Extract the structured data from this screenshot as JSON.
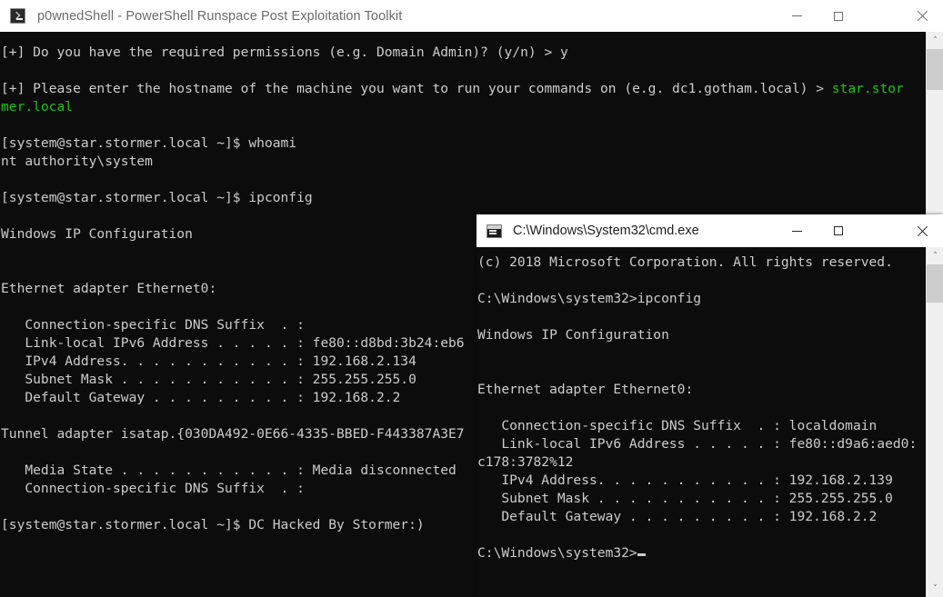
{
  "powershell_window": {
    "title": "p0wnedShell - PowerShell Runspace Post Exploitation Toolkit",
    "icon": "powershell-prompt-icon",
    "controls": {
      "minimize": "minimize-icon",
      "maximize": "maximize-icon",
      "close": "close-icon"
    },
    "scrollbar": {
      "up_arrow": "˄",
      "down_arrow": "˅"
    },
    "lines": [
      {
        "segments": [
          {
            "text": "[+] Do you have the required permissions (e.g. Domain Admin)? (y/n) > y",
            "color": "default"
          }
        ]
      },
      {
        "segments": [
          {
            "text": "",
            "color": "default"
          }
        ]
      },
      {
        "segments": [
          {
            "text": "[+] Please enter the hostname of the machine you want to run your commands on (e.g. dc1.gotham.local) > ",
            "color": "default"
          },
          {
            "text": "star.stor",
            "color": "green"
          }
        ]
      },
      {
        "segments": [
          {
            "text": "mer.local",
            "color": "green"
          }
        ]
      },
      {
        "segments": [
          {
            "text": "",
            "color": "default"
          }
        ]
      },
      {
        "segments": [
          {
            "text": "[system@star.stormer.local ~]$ whoami",
            "color": "default"
          }
        ]
      },
      {
        "segments": [
          {
            "text": "nt authority\\system",
            "color": "default"
          }
        ]
      },
      {
        "segments": [
          {
            "text": "",
            "color": "default"
          }
        ]
      },
      {
        "segments": [
          {
            "text": "[system@star.stormer.local ~]$ ipconfig",
            "color": "default"
          }
        ]
      },
      {
        "segments": [
          {
            "text": "",
            "color": "default"
          }
        ]
      },
      {
        "segments": [
          {
            "text": "Windows IP Configuration",
            "color": "default"
          }
        ]
      },
      {
        "segments": [
          {
            "text": "",
            "color": "default"
          }
        ]
      },
      {
        "segments": [
          {
            "text": "",
            "color": "default"
          }
        ]
      },
      {
        "segments": [
          {
            "text": "Ethernet adapter Ethernet0:",
            "color": "default"
          }
        ]
      },
      {
        "segments": [
          {
            "text": "",
            "color": "default"
          }
        ]
      },
      {
        "segments": [
          {
            "text": "   Connection-specific DNS Suffix  . :",
            "color": "default"
          }
        ]
      },
      {
        "segments": [
          {
            "text": "   Link-local IPv6 Address . . . . . : fe80::d8bd:3b24:eb6",
            "color": "default"
          }
        ]
      },
      {
        "segments": [
          {
            "text": "   IPv4 Address. . . . . . . . . . . : 192.168.2.134",
            "color": "default"
          }
        ]
      },
      {
        "segments": [
          {
            "text": "   Subnet Mask . . . . . . . . . . . : 255.255.255.0",
            "color": "default"
          }
        ]
      },
      {
        "segments": [
          {
            "text": "   Default Gateway . . . . . . . . . : 192.168.2.2",
            "color": "default"
          }
        ]
      },
      {
        "segments": [
          {
            "text": "",
            "color": "default"
          }
        ]
      },
      {
        "segments": [
          {
            "text": "Tunnel adapter isatap.{030DA492-0E66-4335-BBED-F443387A3E7",
            "color": "default"
          }
        ]
      },
      {
        "segments": [
          {
            "text": "",
            "color": "default"
          }
        ]
      },
      {
        "segments": [
          {
            "text": "   Media State . . . . . . . . . . . : Media disconnected",
            "color": "default"
          }
        ]
      },
      {
        "segments": [
          {
            "text": "   Connection-specific DNS Suffix  . :",
            "color": "default"
          }
        ]
      },
      {
        "segments": [
          {
            "text": "",
            "color": "default"
          }
        ]
      },
      {
        "segments": [
          {
            "text": "[system@star.stormer.local ~]$ DC Hacked By Stormer:)",
            "color": "default"
          }
        ]
      }
    ]
  },
  "cmd_window": {
    "title": "C:\\Windows\\System32\\cmd.exe",
    "icon": "console-window-icon",
    "controls": {
      "minimize": "minimize-icon",
      "maximize": "maximize-icon",
      "close": "close-icon"
    },
    "scrollbar": {
      "up_arrow": "˄",
      "down_arrow": "˅"
    },
    "lines": [
      {
        "segments": [
          {
            "text": "(c) 2018 Microsoft Corporation. All rights reserved.",
            "color": "default"
          }
        ]
      },
      {
        "segments": [
          {
            "text": "",
            "color": "default"
          }
        ]
      },
      {
        "segments": [
          {
            "text": "C:\\Windows\\system32>ipconfig",
            "color": "default"
          }
        ]
      },
      {
        "segments": [
          {
            "text": "",
            "color": "default"
          }
        ]
      },
      {
        "segments": [
          {
            "text": "Windows IP Configuration",
            "color": "default"
          }
        ]
      },
      {
        "segments": [
          {
            "text": "",
            "color": "default"
          }
        ]
      },
      {
        "segments": [
          {
            "text": "",
            "color": "default"
          }
        ]
      },
      {
        "segments": [
          {
            "text": "Ethernet adapter Ethernet0:",
            "color": "default"
          }
        ]
      },
      {
        "segments": [
          {
            "text": "",
            "color": "default"
          }
        ]
      },
      {
        "segments": [
          {
            "text": "   Connection-specific DNS Suffix  . : localdomain",
            "color": "default"
          }
        ]
      },
      {
        "segments": [
          {
            "text": "   Link-local IPv6 Address . . . . . : fe80::d9a6:aed0:",
            "color": "default"
          }
        ]
      },
      {
        "segments": [
          {
            "text": "c178:3782%12",
            "color": "default"
          }
        ]
      },
      {
        "segments": [
          {
            "text": "   IPv4 Address. . . . . . . . . . . : 192.168.2.139",
            "color": "default"
          }
        ]
      },
      {
        "segments": [
          {
            "text": "   Subnet Mask . . . . . . . . . . . : 255.255.255.0",
            "color": "default"
          }
        ]
      },
      {
        "segments": [
          {
            "text": "   Default Gateway . . . . . . . . . : 192.168.2.2",
            "color": "default"
          }
        ]
      },
      {
        "segments": [
          {
            "text": "",
            "color": "default"
          }
        ]
      },
      {
        "segments": [
          {
            "text": "C:\\Windows\\system32>",
            "color": "default",
            "cursor": true
          }
        ]
      }
    ]
  },
  "colors": {
    "console_background": "#0c0c0c",
    "console_text": "#cccccc",
    "green_text": "#16c60c",
    "titlebar_background": "#ffffff",
    "ps_title_text": "#6b6b6b",
    "cmd_title_text": "#1d1d1d",
    "scrollbar_track": "#f0f0f0",
    "scrollbar_thumb": "#cdcdcd"
  }
}
